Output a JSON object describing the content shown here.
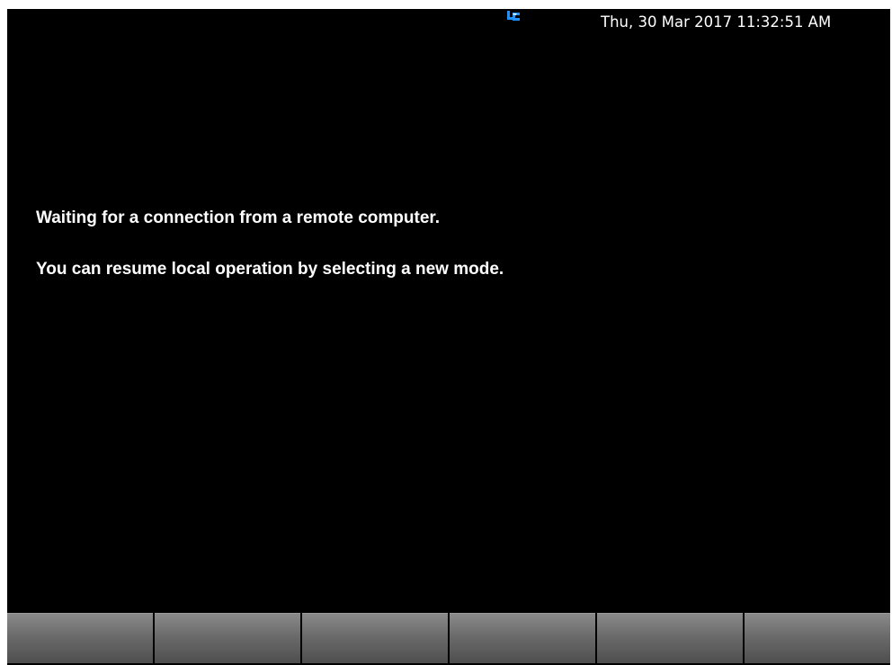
{
  "status_bar": {
    "remote_icon": "remote-control-icon",
    "remote_icon_color": "#1e90ff",
    "datetime": "Thu, 30 Mar 2017 11:32:51 AM"
  },
  "message": {
    "line1": "Waiting for a connection from a remote computer.",
    "line2": "You can resume local operation by selecting a new mode."
  },
  "softkeys": [
    {
      "label": ""
    },
    {
      "label": ""
    },
    {
      "label": ""
    },
    {
      "label": ""
    },
    {
      "label": ""
    },
    {
      "label": ""
    }
  ],
  "colors": {
    "screen_background": "#000000",
    "text": "#ffffff",
    "softkey_gray": "#6b6b6b"
  }
}
